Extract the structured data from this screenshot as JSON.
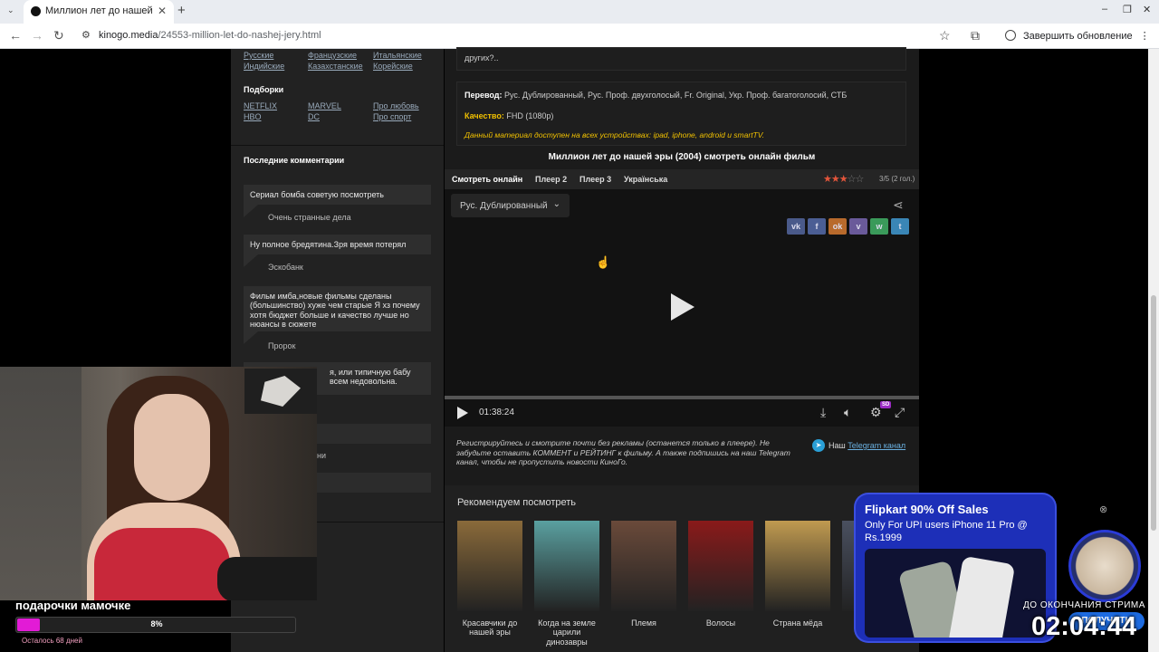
{
  "browser": {
    "tab_title": "Миллион лет до нашей эры",
    "url_host": "kinogo.media",
    "url_path": "/24553-million-let-do-nashej-jery.html",
    "update_label": "Завершить обновление"
  },
  "sidebar": {
    "genre_links": [
      [
        "Русские",
        "Французские",
        "Итальянские"
      ],
      [
        "Индийские",
        "Казахстанские",
        "Корейские"
      ]
    ],
    "collections_heading": "Подборки",
    "collections": [
      [
        "NETFLIX",
        "MARVEL",
        "Про любовь"
      ],
      [
        "HBO",
        "DC",
        "Про спорт"
      ]
    ],
    "comments_heading": "Последние комментарии",
    "comments": [
      {
        "text": "Сериал бомба советую посмотреть",
        "title": "Очень странные дела"
      },
      {
        "text": "Ну полное бредятина.Зря время потерял",
        "title": "Эскобанк"
      },
      {
        "text": "Фильм имба,новые фильмы сделаны (большинство) хуже чем старые Я хз почему хотя бюджет больше и качество лучше но нюансы в сюжете",
        "title": "Пророк"
      },
      {
        "text": "я, или типичную бабу всем недовольна.",
        "title": ""
      }
    ],
    "partial_text": "ни"
  },
  "main": {
    "top_text": "других?..",
    "translation_label": "Перевод:",
    "translation_value": "Рус. Дублированный, Рус. Проф. двухголосый, Fr. Original, Укр. Проф. багатоголосий, СТБ",
    "quality_label": "Качество:",
    "quality_value": "FHD (1080p)",
    "devices_note": "Данный материал доступен на всех устройствах: ipad, iphone, android и smartTV.",
    "movie_title": "Миллион лет до нашей эры (2004) смотреть онлайн фильм",
    "player_tabs": [
      "Смотреть онлайн",
      "Плеер 2",
      "Плеер 3",
      "Українська"
    ],
    "rating": {
      "value": 3,
      "max": 5,
      "text": "3/5 (2 гол.)"
    },
    "player": {
      "dub_select": "Рус. Дублированный",
      "time": "01:38:24",
      "progress": 0.0,
      "social": [
        {
          "name": "vk",
          "label": "vk",
          "color": "#4a5a8a"
        },
        {
          "name": "facebook",
          "label": "f",
          "color": "#4b5e94"
        },
        {
          "name": "odnoklassniki",
          "label": "ok",
          "color": "#b86a2c"
        },
        {
          "name": "viber",
          "label": "v",
          "color": "#6a5a9a"
        },
        {
          "name": "whatsapp",
          "label": "w",
          "color": "#3a9a5a"
        },
        {
          "name": "telegram",
          "label": "t",
          "color": "#3a86b6"
        }
      ],
      "sd_badge": "SD"
    },
    "register_note": "Регистрируйтесь и смотрите почти без рекламы (останется только в плеере). Не забудьте оставить КОММЕНТ и РЕЙТИНГ к фильму. А также подпишись на наш Telegram канал, чтобы не пропустить новости КиноГо.",
    "telegram_prefix": "Наш",
    "telegram_link": "Telegram канал",
    "recommend_heading": "Рекомендуем посмотреть",
    "recommendations": [
      {
        "title": "Красавчики до нашей эры",
        "color": "#8a6a3a"
      },
      {
        "title": "Когда на земле царили динозавры",
        "color": "#5aa0a0"
      },
      {
        "title": "Племя",
        "color": "#6a4a3a"
      },
      {
        "title": "Волосы",
        "color": "#8a1a1a"
      },
      {
        "title": "Страна мёда",
        "color": "#c09a50"
      },
      {
        "title": "",
        "color": "#4a5060"
      }
    ]
  },
  "stream_overlay": {
    "goal_label": "подарочки мамочке",
    "goal_percent": 8,
    "goal_percent_text": "8%",
    "days_left": "Осталось 68 дней",
    "timer_label": "ДО ОКОНЧАНИЯ СТРИМА",
    "timer": "02:04:44"
  },
  "ad": {
    "title": "Flipkart 90% Off Sales",
    "subtitle": "Only For UPI users iPhone 11 Pro @ Rs.1999",
    "button": "ПОЛУЧИТЬ"
  }
}
